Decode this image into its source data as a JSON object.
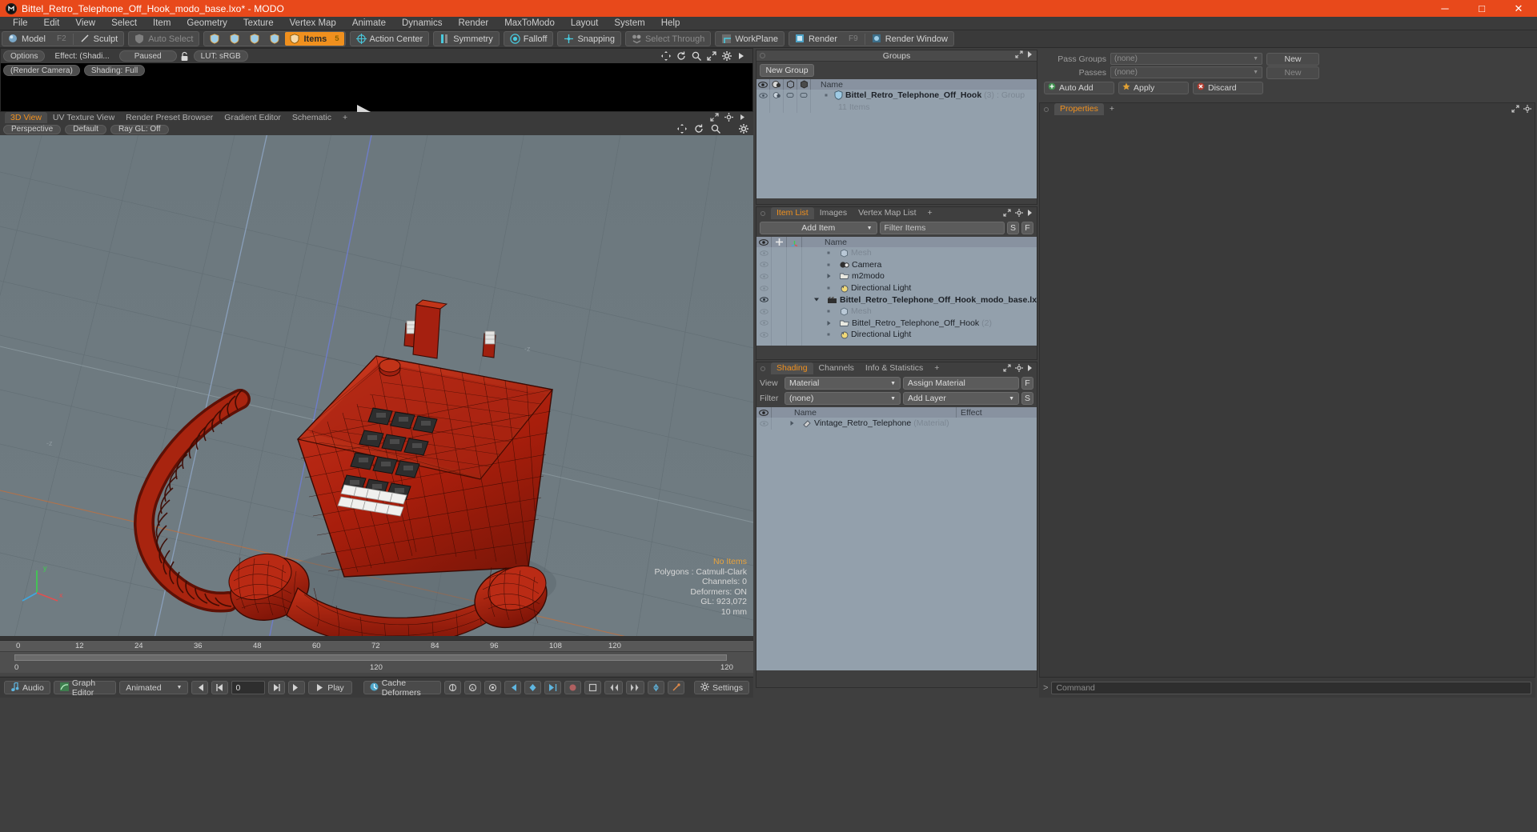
{
  "window": {
    "title": "Bittel_Retro_Telephone_Off_Hook_modo_base.lxo* - MODO",
    "minimize": "─",
    "maximize": "□",
    "close": "✕"
  },
  "menubar": {
    "items": [
      "File",
      "Edit",
      "View",
      "Select",
      "Item",
      "Geometry",
      "Texture",
      "Vertex Map",
      "Animate",
      "Dynamics",
      "Render",
      "MaxToModo",
      "Layout",
      "System",
      "Help"
    ]
  },
  "toolbar": {
    "mode_model": "Model",
    "mode_model_key": "F2",
    "mode_sculpt": "Sculpt",
    "auto_select": "Auto Select",
    "items": "Items",
    "items_key": "5",
    "action_center": "Action Center",
    "symmetry": "Symmetry",
    "falloff": "Falloff",
    "snapping": "Snapping",
    "select_through": "Select Through",
    "workplane": "WorkPlane",
    "render": "Render",
    "render_key": "F9",
    "render_window": "Render Window"
  },
  "preview": {
    "options": "Options",
    "effect": "Effect: (Shadi...",
    "paused": "Paused",
    "lut": "LUT: sRGB",
    "render_camera": "(Render Camera)",
    "shading": "Shading: Full"
  },
  "viewport": {
    "tabs": [
      {
        "label": "3D View",
        "active": true
      },
      {
        "label": "UV Texture View",
        "active": false
      },
      {
        "label": "Render Preset Browser",
        "active": false
      },
      {
        "label": "Gradient Editor",
        "active": false
      },
      {
        "label": "Schematic",
        "active": false
      },
      {
        "label": "+",
        "active": false
      }
    ],
    "perspective": "Perspective",
    "default": "Default",
    "raygl": "Ray GL: Off",
    "stats": {
      "no_items": "No Items",
      "polygons": "Polygons : Catmull-Clark",
      "channels": "Channels: 0",
      "deformers": "Deformers: ON",
      "gl": "GL: 923,072",
      "scale": "10 mm"
    },
    "axis": {
      "x": "x",
      "y": "y",
      "z": "z"
    }
  },
  "timeline": {
    "ticks": [
      "0",
      "12",
      "24",
      "36",
      "48",
      "60",
      "72",
      "84",
      "96",
      "108",
      "120"
    ],
    "center_label": "120",
    "right_label": "120",
    "left_label": "0"
  },
  "bottombar": {
    "audio": "Audio",
    "graph_editor": "Graph Editor",
    "animated": "Animated",
    "frame_value": "0",
    "play": "Play",
    "cache_deformers": "Cache Deformers",
    "settings": "Settings"
  },
  "groups_panel": {
    "title": "Groups",
    "new_group": "New Group",
    "columns": [
      "Name"
    ],
    "rows": [
      {
        "name": "Bittel_Retro_Telephone_Off_Hook",
        "count": "(3)",
        "type": ": Group",
        "bold": true
      },
      {
        "name": "11 Items",
        "count": "",
        "type": "",
        "bold": false
      }
    ]
  },
  "item_list_panel": {
    "tabs": [
      {
        "label": "Item List",
        "active": true
      },
      {
        "label": "Images",
        "active": false
      },
      {
        "label": "Vertex Map List",
        "active": false
      },
      {
        "label": "+",
        "active": false
      }
    ],
    "add_item": "Add Item",
    "filter_items": "Filter Items",
    "btn_s": "S",
    "btn_f": "F",
    "columns": [
      "Name"
    ],
    "rows": [
      {
        "name": "Mesh",
        "suffix": "",
        "icon": "mesh-icon",
        "dim": true,
        "bold": false,
        "indent": 30,
        "arrow": "dot"
      },
      {
        "name": "Camera",
        "suffix": "",
        "icon": "camera-icon",
        "dim": false,
        "bold": false,
        "indent": 30,
        "arrow": "dot"
      },
      {
        "name": "m2modo",
        "suffix": "",
        "icon": "folder-icon",
        "dim": false,
        "bold": false,
        "indent": 30,
        "arrow": "tri"
      },
      {
        "name": "Directional Light",
        "suffix": "",
        "icon": "light-icon",
        "dim": false,
        "bold": false,
        "indent": 30,
        "arrow": "dot"
      },
      {
        "name": "Bittel_Retro_Telephone_Off_Hook_modo_base.lxo*",
        "suffix": "",
        "icon": "scene-icon",
        "dim": false,
        "bold": true,
        "indent": 14,
        "arrow": "tridown"
      },
      {
        "name": "Mesh",
        "suffix": "",
        "icon": "mesh-icon",
        "dim": true,
        "bold": false,
        "indent": 30,
        "arrow": "dot"
      },
      {
        "name": "Bittel_Retro_Telephone_Off_Hook",
        "suffix": "(2)",
        "icon": "folder-icon",
        "dim": false,
        "bold": false,
        "indent": 30,
        "arrow": "tri"
      },
      {
        "name": "Directional Light",
        "suffix": "",
        "icon": "light-icon",
        "dim": false,
        "bold": false,
        "indent": 30,
        "arrow": "dot"
      }
    ]
  },
  "shading_panel": {
    "tabs": [
      {
        "label": "Shading",
        "active": true
      },
      {
        "label": "Channels",
        "active": false
      },
      {
        "label": "Info & Statistics",
        "active": false
      },
      {
        "label": "+",
        "active": false
      }
    ],
    "view_label": "View",
    "view_value": "Material",
    "assign_material": "Assign Material",
    "btn_f": "F",
    "filter_label": "Filter",
    "filter_value": "(none)",
    "add_layer": "Add Layer",
    "btn_s": "S",
    "columns": [
      "Name",
      "Effect"
    ],
    "rows": [
      {
        "name": "Vintage_Retro_Telephone",
        "suffix": "(Material)",
        "effect": ""
      }
    ]
  },
  "passes_panel": {
    "pass_groups_label": "Pass Groups",
    "pass_groups_value": "(none)",
    "new_label": "New",
    "passes_label": "Passes",
    "passes_value": "(none)",
    "new_label2": "New",
    "auto_add": "Auto Add",
    "apply": "Apply",
    "discard": "Discard"
  },
  "properties_panel": {
    "tabs": [
      {
        "label": "Properties",
        "active": true
      },
      {
        "label": "+",
        "active": false
      }
    ]
  },
  "command_bar": {
    "placeholder": "Command",
    "prompt": ">"
  },
  "colors": {
    "accent": "#f0901e",
    "title_bar": "#e8491b",
    "panel_bg": "#3f3f3f",
    "list_bg": "#93a0ac",
    "list_header": "#8892a0",
    "viewport_bg": "#6e7a80",
    "model_red": "#a52010"
  }
}
